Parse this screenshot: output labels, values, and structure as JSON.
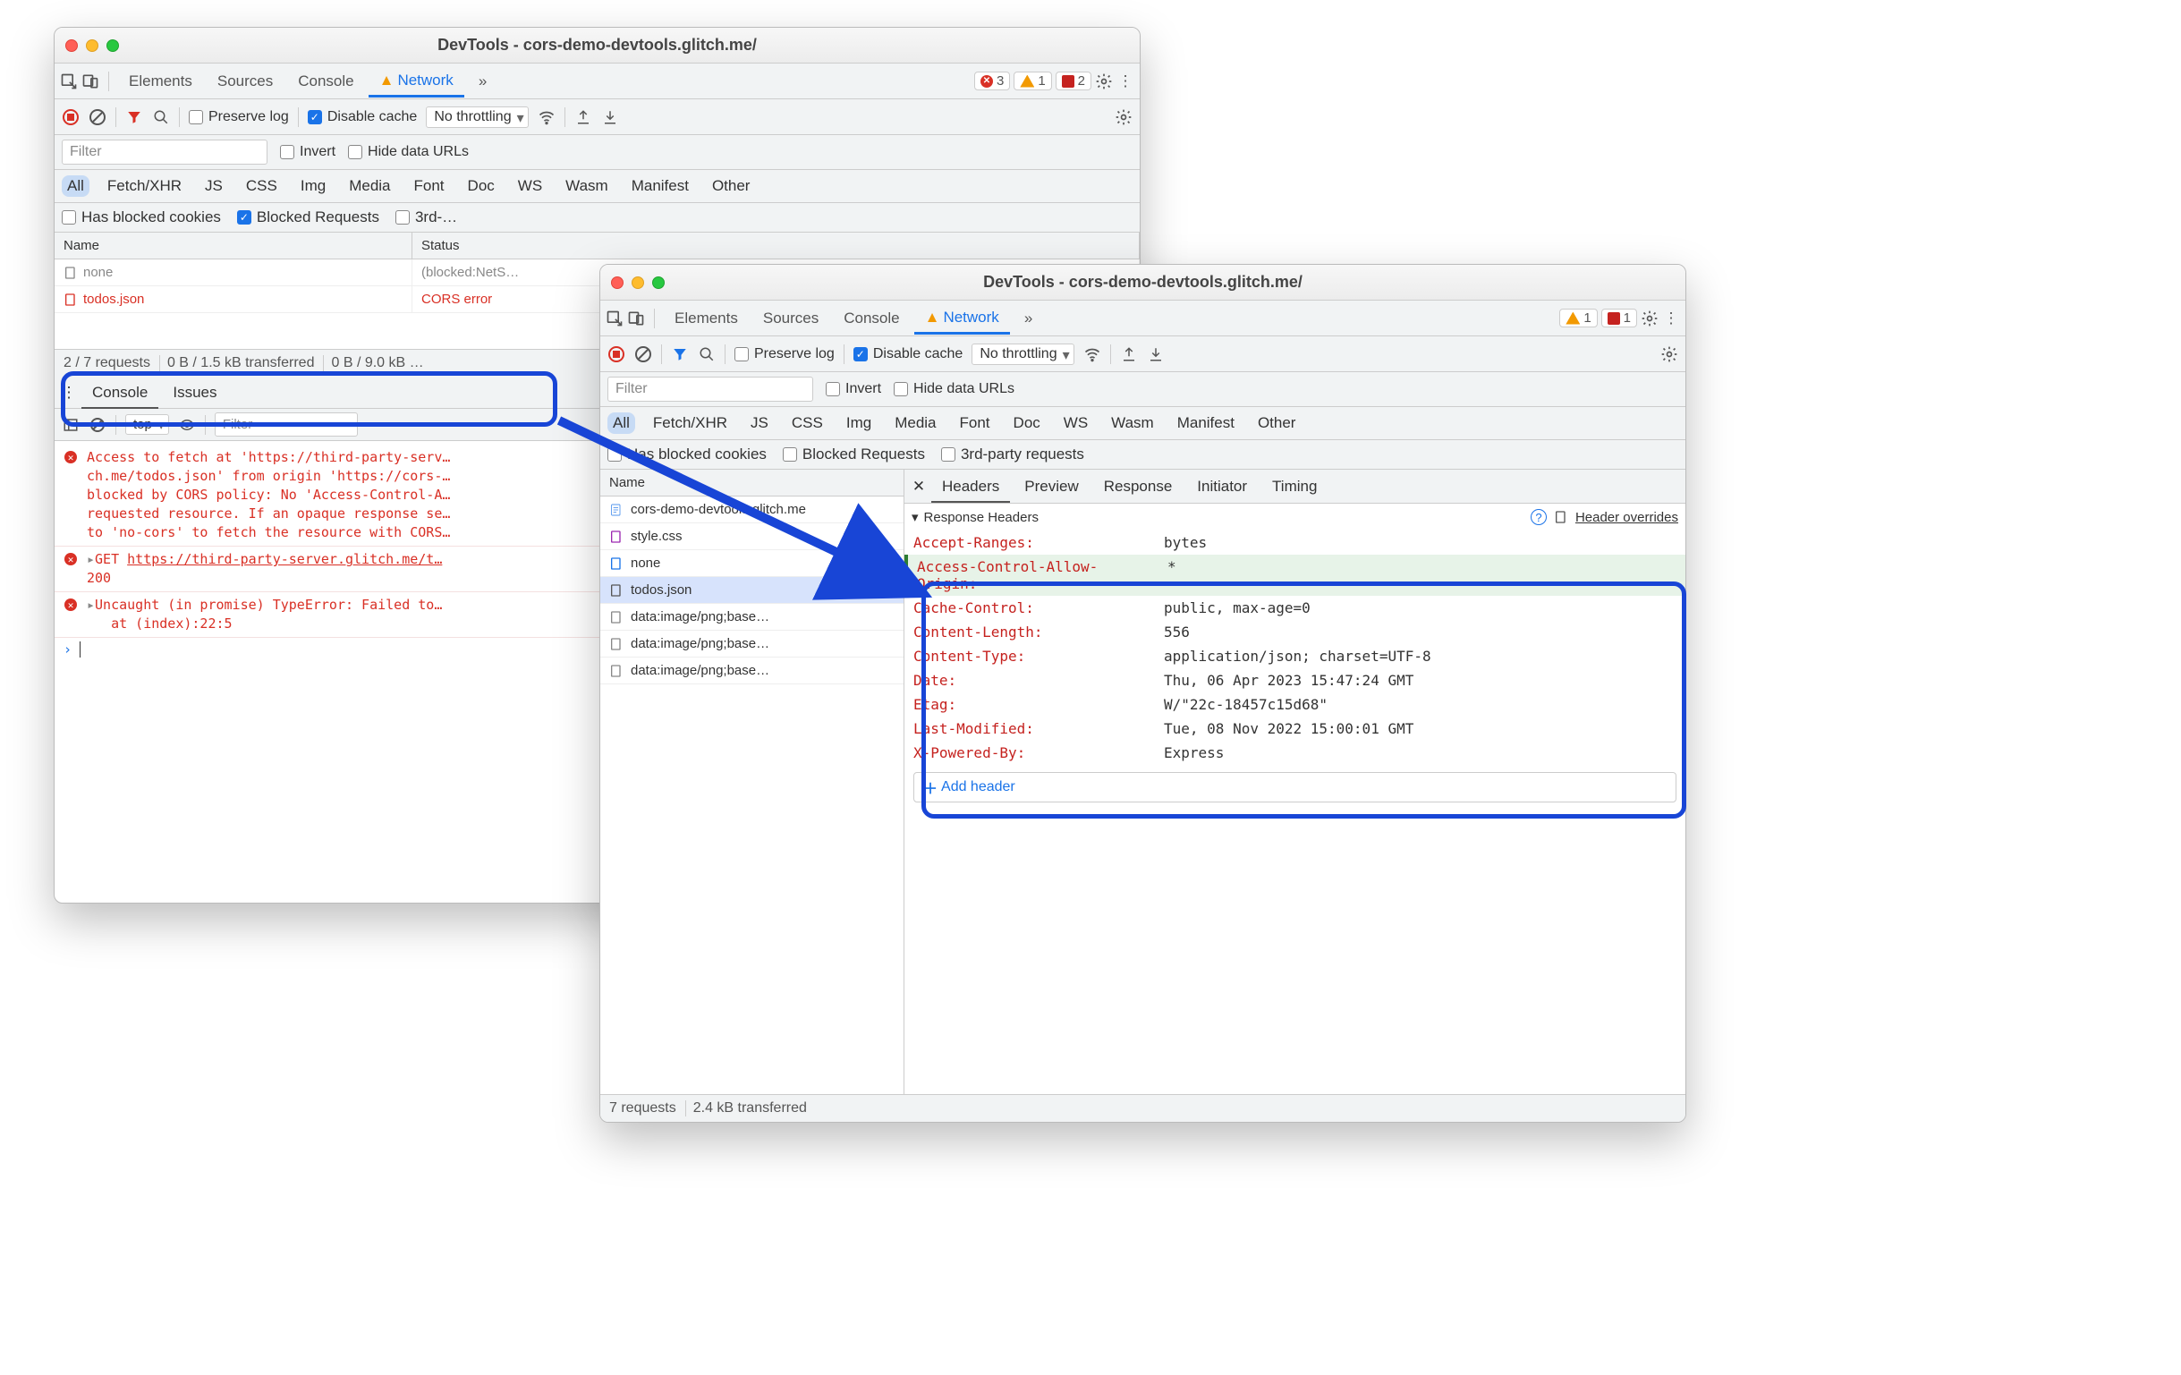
{
  "window1": {
    "title": "DevTools - cors-demo-devtools.glitch.me/",
    "tabs": [
      "Elements",
      "Sources",
      "Console",
      "Network"
    ],
    "errBadge": "3",
    "warnBadge": "1",
    "sqBadge": "2",
    "preserve": "Preserve log",
    "disable": "Disable cache",
    "throttle": "No throttling",
    "filterPH": "Filter",
    "invert": "Invert",
    "hidedata": "Hide data URLs",
    "types": [
      "All",
      "Fetch/XHR",
      "JS",
      "CSS",
      "Img",
      "Media",
      "Font",
      "Doc",
      "WS",
      "Wasm",
      "Manifest",
      "Other"
    ],
    "opt1": "Has blocked cookies",
    "opt2": "Blocked Requests",
    "opt3": "3rd-…",
    "colName": "Name",
    "colStatus": "Status",
    "rowNone": "none",
    "rowNoneStatus": "(blocked:NetS…",
    "rowTodos": "todos.json",
    "rowTodosStatus": "CORS error",
    "stat1": "2 / 7 requests",
    "stat2": "0 B / 1.5 kB transferred",
    "stat3": "0 B / 9.0 kB …",
    "drawerTabs": [
      "Console",
      "Issues"
    ],
    "ctxTop": "top",
    "cFilterPH": "Filter",
    "msg1": "Access to fetch at 'https://third-party-serv…\nch.me/todos.json' from origin 'https://cors-…\nblocked by CORS policy: No 'Access-Control-A…\nrequested resource. If an opaque response se…\nto 'no-cors' to fetch the resource with CORS…",
    "msg2a": "GET ",
    "msg2b": "https://third-party-server.glitch.me/t…",
    "msg2c": "200",
    "msg3a": "Uncaught (in promise) TypeError: Failed to…",
    "msg3b": "   at (index):22:5"
  },
  "window2": {
    "title": "DevTools - cors-demo-devtools.glitch.me/",
    "tabs": [
      "Elements",
      "Sources",
      "Console",
      "Network"
    ],
    "warnBadge": "1",
    "sqBadge": "1",
    "preserve": "Preserve log",
    "disable": "Disable cache",
    "throttle": "No throttling",
    "filterPH": "Filter",
    "invert": "Invert",
    "hidedata": "Hide data URLs",
    "types": [
      "All",
      "Fetch/XHR",
      "JS",
      "CSS",
      "Img",
      "Media",
      "Font",
      "Doc",
      "WS",
      "Wasm",
      "Manifest",
      "Other"
    ],
    "opt1": "Has blocked cookies",
    "opt2": "Blocked Requests",
    "opt3": "3rd-party requests",
    "colName": "Name",
    "files": [
      "cors-demo-devtools.glitch.me",
      "style.css",
      "none",
      "todos.json",
      "data:image/png;base…",
      "data:image/png;base…",
      "data:image/png;base…"
    ],
    "stat1": "7 requests",
    "stat2": "2.4 kB transferred",
    "detailTabs": [
      "Headers",
      "Preview",
      "Response",
      "Initiator",
      "Timing"
    ],
    "respSection": "Response Headers",
    "overrideLink": "Header overrides",
    "headers": [
      {
        "n": "Accept-Ranges:",
        "v": "bytes",
        "added": false
      },
      {
        "n": "Access-Control-Allow-Origin:",
        "v": "*",
        "added": true
      },
      {
        "n": "Cache-Control:",
        "v": "public, max-age=0",
        "added": false
      },
      {
        "n": "Content-Length:",
        "v": "556",
        "added": false
      },
      {
        "n": "Content-Type:",
        "v": "application/json; charset=UTF-8",
        "added": false
      },
      {
        "n": "Date:",
        "v": "Thu, 06 Apr 2023 15:47:24 GMT",
        "added": false
      },
      {
        "n": "Etag:",
        "v": "W/\"22c-18457c15d68\"",
        "added": false
      },
      {
        "n": "Last-Modified:",
        "v": "Tue, 08 Nov 2022 15:00:01 GMT",
        "added": false
      },
      {
        "n": "X-Powered-By:",
        "v": "Express",
        "added": false
      }
    ],
    "addHeader": "Add header"
  }
}
